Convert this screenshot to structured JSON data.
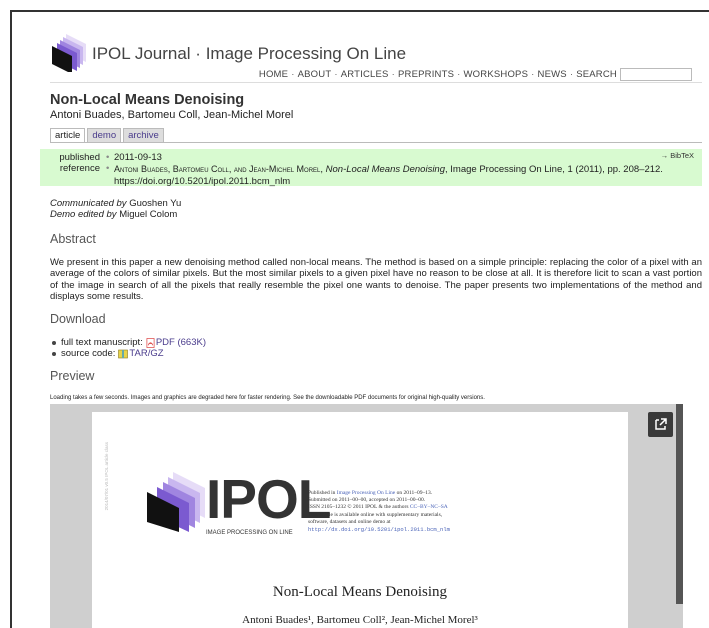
{
  "site": {
    "title": "IPOL Journal · Image Processing On Line",
    "nav": [
      "HOME",
      "ABOUT",
      "ARTICLES",
      "PREPRINTS",
      "WORKSHOPS",
      "NEWS",
      "SEARCH"
    ]
  },
  "paper": {
    "title": "Non-Local Means Denoising",
    "authors": "Antoni Buades, Bartomeu Coll, Jean-Michel Morel"
  },
  "tabs": [
    "article",
    "demo",
    "archive"
  ],
  "info": {
    "published_label": "published",
    "published_value": "2011-09-13",
    "reference_label": "reference",
    "reference_authors": "Antoni Buades, Bartomeu Coll, and Jean-Michel Morel",
    "reference_title": "Non-Local Means Denoising",
    "reference_rest": ", Image Processing On Line, 1 (2011), pp. 208–212. https://doi.org/10.5201/ipol.2011.bcm_nlm",
    "bibtex": "→ BibTeX"
  },
  "credits": {
    "communicated_label": "Communicated by",
    "communicated_name": "Guoshen Yu",
    "demo_label": "Demo edited by",
    "demo_name": "Miguel Colom"
  },
  "abstract": {
    "heading": "Abstract",
    "text": "We present in this paper a new denoising method called non-local means. The method is based on a simple principle: replacing the color of a pixel with an average of the colors of similar pixels. But the most similar pixels to a given pixel have no reason to be close at all. It is therefore licit to scan a vast portion of the image in search of all the pixels that really resemble the pixel one wants to denoise. The paper presents two implementations of the method and displays some results."
  },
  "download": {
    "heading": "Download",
    "manuscript_label": "full text manuscript:",
    "manuscript_link": "PDF (663K)",
    "source_label": "source code:",
    "source_link": "TAR/GZ"
  },
  "preview": {
    "heading": "Preview",
    "note": "Loading takes a few seconds. Images and graphics are degraded here for faster rendering. See the downloadable PDF documents for original high-quality versions.",
    "page": {
      "side_text": "2014/07/01 v0.5 IPOL article class",
      "logo_text": "IPOL",
      "logo_sub": "IMAGE PROCESSING ON LINE",
      "pub_line1_a": "Published in ",
      "pub_line1_link": "Image Processing On Line",
      "pub_line1_b": " on 2011–09–13.",
      "pub_line2": "Submitted on 2011–00–00, accepted on 2011–00–00.",
      "pub_line3_a": "ISSN 2105–1232 © 2011 IPOL & the authors ",
      "pub_line3_link": "CC–BY–NC–SA",
      "pub_line4": "This article is available online with supplementary materials,",
      "pub_line5": "software, datasets and online demo at",
      "pub_line6": "http://dx.doi.org/10.5201/ipol.2011.bcm_nlm",
      "title": "Non-Local Means Denoising",
      "authors": "Antoni Buades¹, Bartomeu Coll², Jean-Michel Morel³"
    }
  },
  "colors": {
    "accent": "#4a3c8c",
    "info_bg": "#d8fad0",
    "logo_purple": "#6a4fc8"
  },
  "icons": [
    "pdf-icon",
    "archive-icon",
    "expand-icon",
    "ipol-logo"
  ]
}
